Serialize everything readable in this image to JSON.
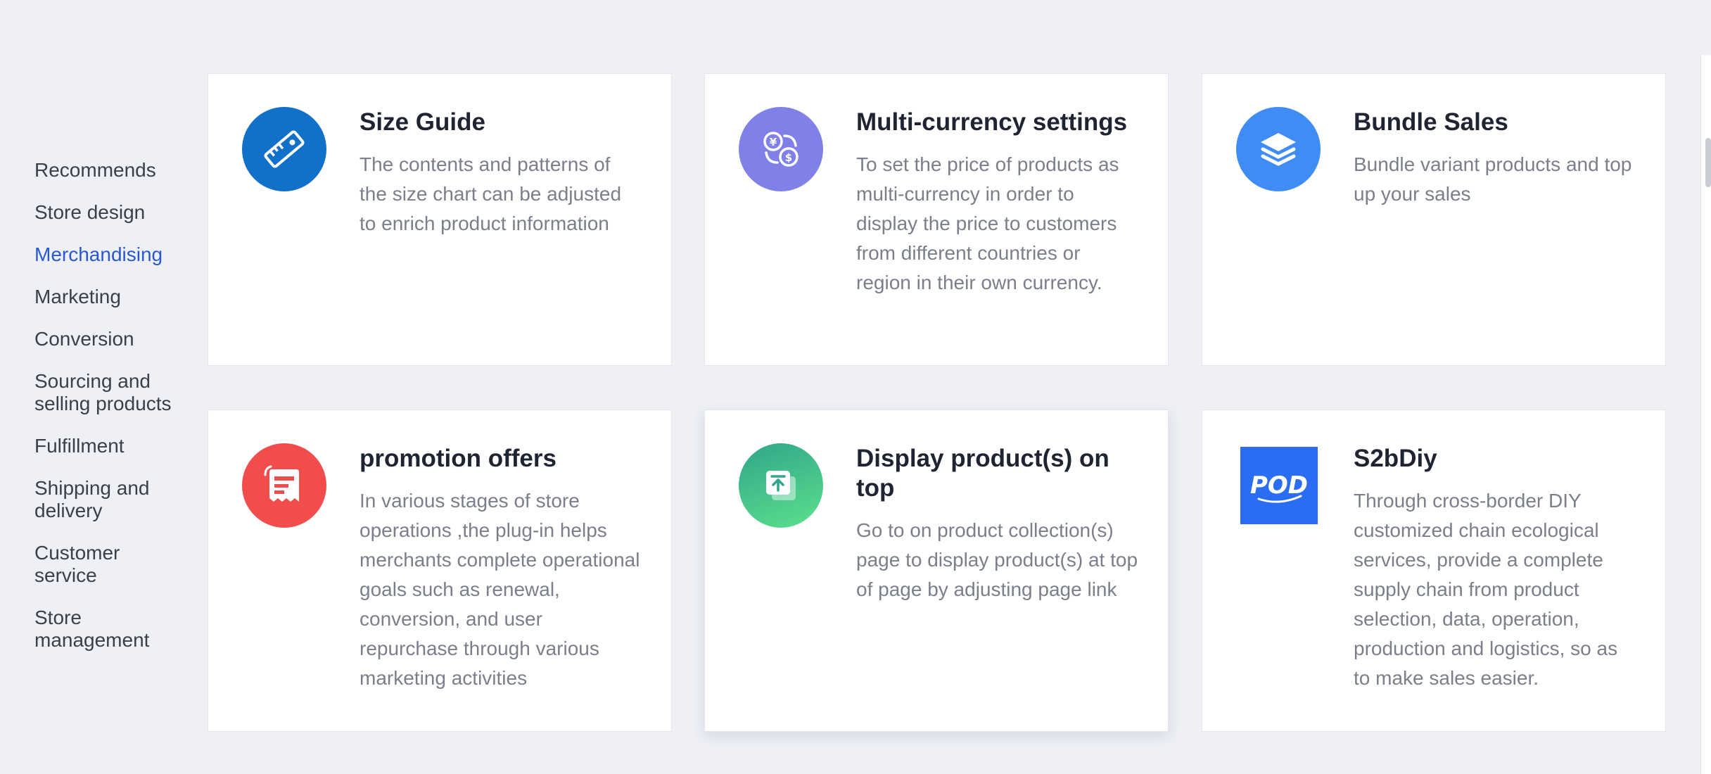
{
  "sidebar": {
    "items": [
      {
        "label": "Recommends"
      },
      {
        "label": "Store design"
      },
      {
        "label": "Merchandising"
      },
      {
        "label": "Marketing"
      },
      {
        "label": "Conversion"
      },
      {
        "label": "Sourcing and selling products"
      },
      {
        "label": "Fulfillment"
      },
      {
        "label": "Shipping and delivery"
      },
      {
        "label": "Customer service"
      },
      {
        "label": "Store management"
      }
    ],
    "active": "Merchandising"
  },
  "cards": [
    {
      "title": "Size Guide",
      "description": "The contents and patterns of the size chart can be adjusted to enrich product information",
      "icon": "ruler-icon",
      "icon_color": "#1170c8"
    },
    {
      "title": "Multi-currency settings",
      "description": "To set the price of products as multi-currency in order to display the price to customers from different countries or region in their own currency.",
      "icon": "currency-exchange-icon",
      "icon_color": "#7f80e8"
    },
    {
      "title": "Bundle Sales",
      "description": "Bundle variant products and top up your sales",
      "icon": "layers-icon",
      "icon_color": "#3f8cf5"
    },
    {
      "title": "promotion offers",
      "description": "In various stages of store operations ,the plug-in helps merchants complete operational goals such as renewal, conversion, and user repurchase through various marketing activities",
      "icon": "receipt-icon",
      "icon_color": "#f24d4d"
    },
    {
      "title": "Display product(s) on top",
      "description": "Go to on product collection(s) page to display product(s) at top of page by adjusting page link",
      "icon": "pin-to-top-icon",
      "icon_color": "#3cc48a"
    },
    {
      "title": "S2bDiy",
      "description": "Through cross-border DIY customized chain ecological services, provide a complete supply chain from product selection, data, operation, production and logistics, so as to make sales easier.",
      "icon": "pod-logo-icon",
      "icon_color": "#2a6cf2",
      "logo_text": "POD"
    }
  ]
}
